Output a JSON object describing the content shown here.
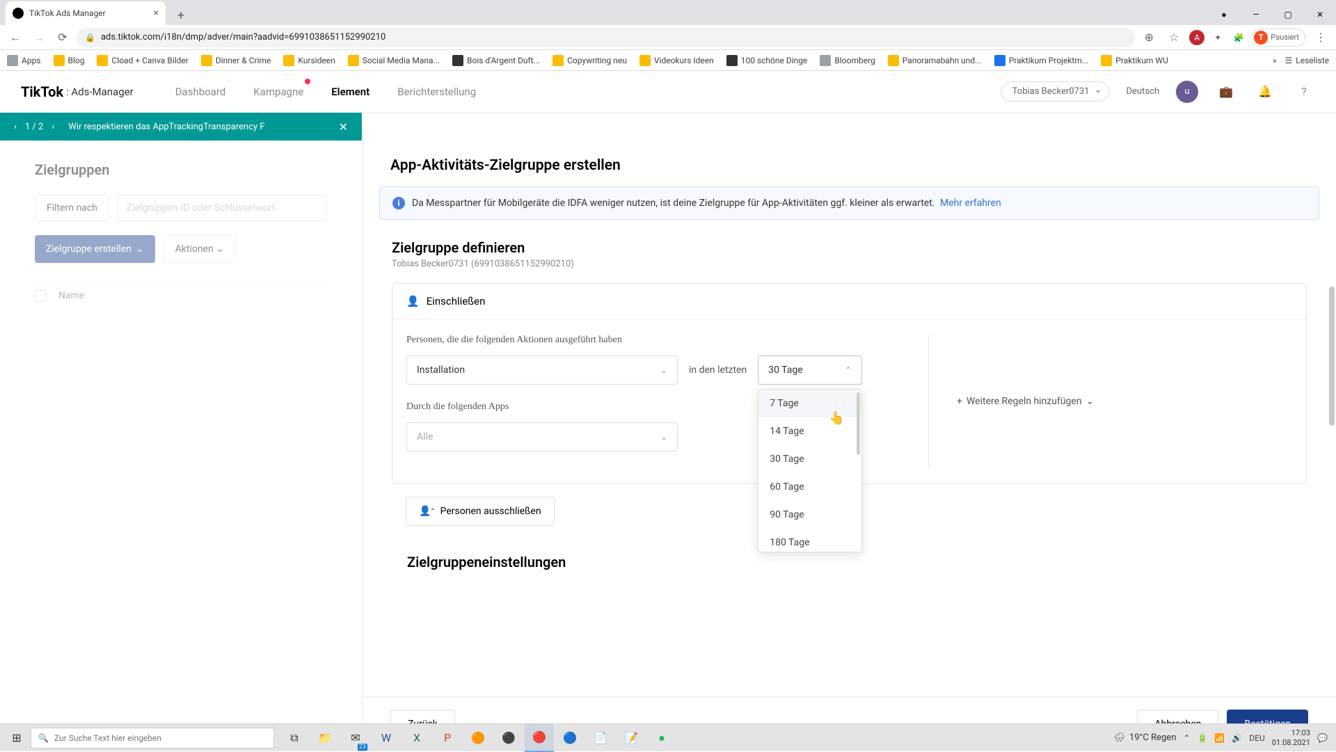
{
  "browser": {
    "tab_title": "TikTok Ads Manager",
    "url": "ads.tiktok.com/i18n/dmp/adver/main?aadvid=6991038651152990210",
    "profile_label": "Pausiert",
    "profile_initial": "T"
  },
  "bookmarks": {
    "apps": "Apps",
    "items": [
      "Blog",
      "Cload + Canva Bilder",
      "Dinner & Crime",
      "Kursideen",
      "Social Media Mana...",
      "Bois d'Argent Duft...",
      "Copywriting neu",
      "Videokurs Ideen",
      "100 schöne Dinge",
      "Bloomberg",
      "Panoramabahn und...",
      "Praktikum Projektm...",
      "Praktikum WU"
    ],
    "reading_list": "Leseliste"
  },
  "tt": {
    "logo": "TikTok",
    "logo_sub": ": Ads-Manager",
    "nav": [
      "Dashboard",
      "Kampagne",
      "Element",
      "Berichterstellung"
    ],
    "user": "Tobias Becker0731",
    "lang": "Deutsch",
    "avatar": "u"
  },
  "banner": {
    "pager": "1  /  2",
    "text": "Wir respektieren das AppTrackingTransparency F"
  },
  "left": {
    "title": "Zielgruppen",
    "filter_btn": "Filtern nach",
    "search_ph": "Zielgruppen-ID oder Schlüsselwort",
    "create_btn": "Zielgruppe erstellen",
    "actions_btn": "Aktionen",
    "col_name": "Name"
  },
  "modal": {
    "title": "App-Aktivitäts-Zielgruppe erstellen",
    "info": "Da Messpartner für Mobilgeräte die IDFA weniger nutzen, ist deine Zielgruppe für App-Aktivitäten ggf. kleiner als erwartet.",
    "info_link": "Mehr erfahren",
    "define_title": "Zielgruppe definieren",
    "define_sub": "Tobias Becker0731 (6991038651152990210)",
    "include": "Einschließen",
    "rule_label": "Personen, die die folgenden Aktionen ausgeführt haben",
    "action_sel": "Installation",
    "in_last": "in den letzten",
    "days_sel": "30 Tage",
    "apps_label": "Durch die folgenden Apps",
    "apps_sel": "Alle",
    "add_rules": "Weitere Regeln hinzufügen",
    "exclude": "Personen ausschließen",
    "settings_title": "Zielgruppeneinstellungen",
    "back": "Zurück",
    "cancel": "Abbrechen",
    "confirm": "Bestätigen",
    "days_options": [
      "7 Tage",
      "14 Tage",
      "30 Tage",
      "60 Tage",
      "90 Tage",
      "180 Tage"
    ]
  },
  "taskbar": {
    "search_ph": "Zur Suche Text hier eingeben",
    "weather": "19°C  Regen",
    "lang": "DEU",
    "time": "17:03",
    "date": "01.08.2021",
    "mail_badge": "23"
  }
}
